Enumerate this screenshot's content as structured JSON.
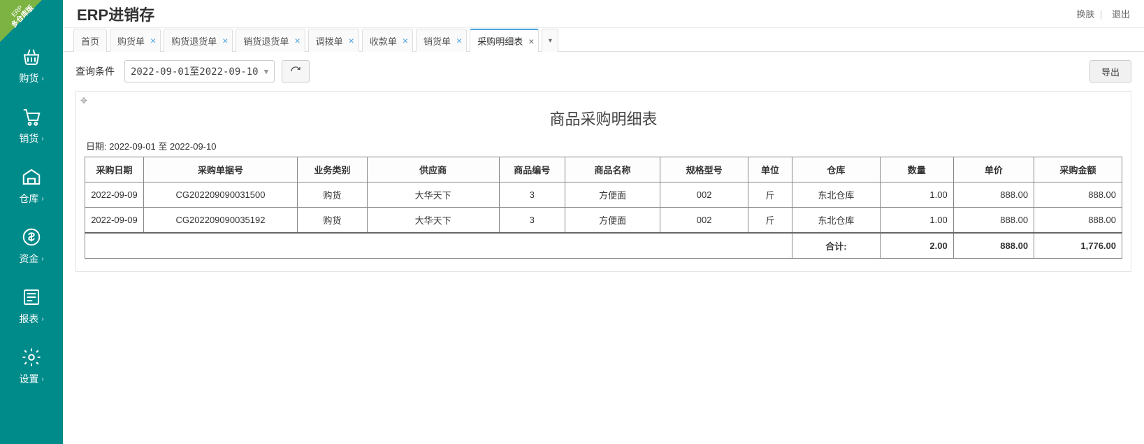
{
  "corner": {
    "line1": "ERP",
    "line2": "多仓库版"
  },
  "brand": "ERP进销存",
  "header_links": {
    "skin": "换肤",
    "logout": "退出"
  },
  "sidebar": {
    "items": [
      {
        "label": "购货"
      },
      {
        "label": "销货"
      },
      {
        "label": "仓库"
      },
      {
        "label": "资金"
      },
      {
        "label": "报表"
      },
      {
        "label": "设置"
      }
    ]
  },
  "tabs": [
    {
      "label": "首页",
      "closable": false,
      "active": false
    },
    {
      "label": "购货单",
      "closable": true,
      "active": false
    },
    {
      "label": "购货退货单",
      "closable": true,
      "active": false
    },
    {
      "label": "销货退货单",
      "closable": true,
      "active": false
    },
    {
      "label": "调拨单",
      "closable": true,
      "active": false
    },
    {
      "label": "收款单",
      "closable": true,
      "active": false
    },
    {
      "label": "销货单",
      "closable": true,
      "active": false
    },
    {
      "label": "采购明细表",
      "closable": true,
      "active": true
    }
  ],
  "toolbar": {
    "query_label": "查询条件",
    "date_range_display": "2022-09-01至2022-09-10",
    "export_label": "导出"
  },
  "report": {
    "title": "商品采购明细表",
    "date_line_prefix": "日期: ",
    "date_from": "2022-09-01",
    "date_to": "2022-09-10",
    "date_sep": " 至 ",
    "columns": [
      "采购日期",
      "采购单据号",
      "业务类别",
      "供应商",
      "商品编号",
      "商品名称",
      "规格型号",
      "单位",
      "仓库",
      "数量",
      "单价",
      "采购金额"
    ],
    "rows": [
      {
        "date": "2022-09-09",
        "order": "CG202209090031500",
        "type": "购货",
        "supplier": "大华天下",
        "pcode": "3",
        "pname": "方便面",
        "spec": "002",
        "unit": "斤",
        "wh": "东北仓库",
        "qty": "1.00",
        "price": "888.00",
        "amount": "888.00"
      },
      {
        "date": "2022-09-09",
        "order": "CG202209090035192",
        "type": "购货",
        "supplier": "大华天下",
        "pcode": "3",
        "pname": "方便面",
        "spec": "002",
        "unit": "斤",
        "wh": "东北仓库",
        "qty": "1.00",
        "price": "888.00",
        "amount": "888.00"
      }
    ],
    "total": {
      "label": "合计:",
      "qty": "2.00",
      "price": "888.00",
      "amount": "1,776.00"
    }
  }
}
